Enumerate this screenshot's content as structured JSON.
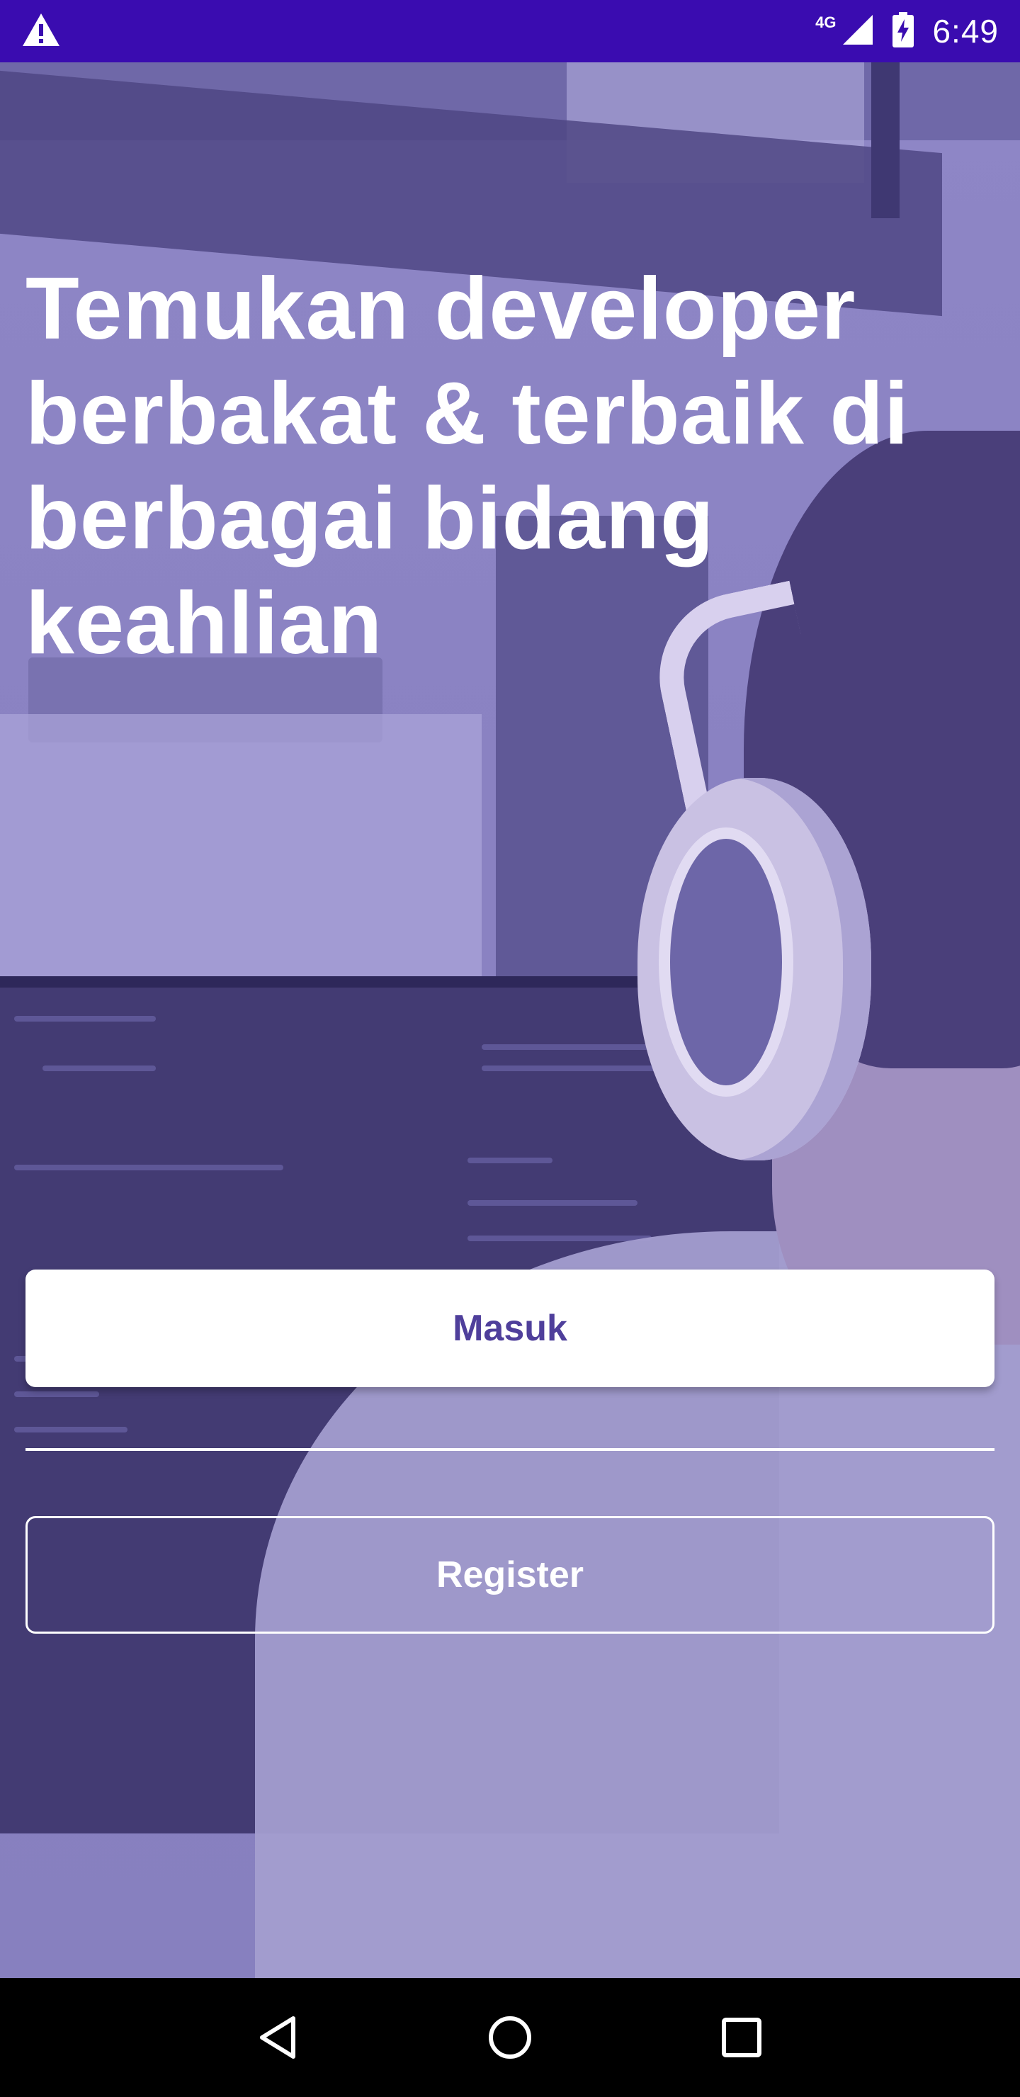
{
  "status_bar": {
    "network": "4G",
    "time": "6:49",
    "icons": [
      "warning-icon",
      "signal-icon",
      "battery-charging-icon"
    ]
  },
  "hero": {
    "headline": "Temukan developer berbakat & terbaik di berbagai bidang keahlian"
  },
  "actions": {
    "login_label": "Masuk",
    "register_label": "Register"
  },
  "colors": {
    "status_bar": "#3a0cb0",
    "overlay": "#8e86c6",
    "login_text": "#4f3f9b"
  },
  "nav": {
    "icons": [
      "back-icon",
      "home-icon",
      "recents-icon"
    ]
  }
}
